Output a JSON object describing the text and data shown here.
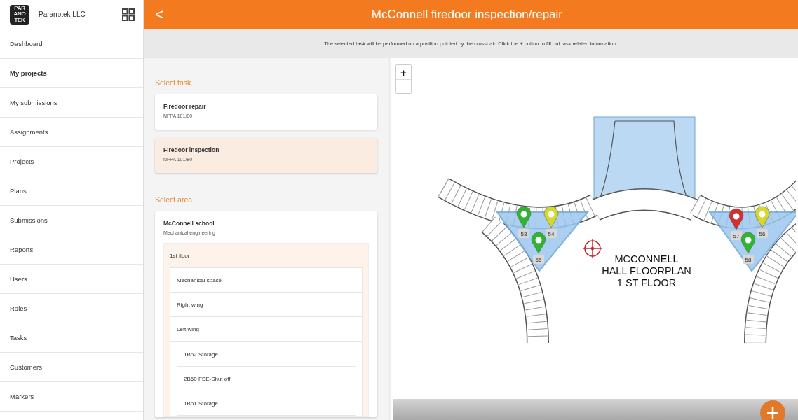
{
  "sidebar": {
    "logo": [
      "PAR",
      "ANO",
      "TEK"
    ],
    "company": "Paranotek LLC",
    "items": [
      {
        "label": "Dashboard",
        "selected": false
      },
      {
        "label": "My projects",
        "selected": true
      },
      {
        "label": "My submissions",
        "selected": false
      },
      {
        "label": "Assignments",
        "selected": false
      },
      {
        "label": "Projects",
        "selected": false
      },
      {
        "label": "Plans",
        "selected": false
      },
      {
        "label": "Submissions",
        "selected": false
      },
      {
        "label": "Reports",
        "selected": false
      },
      {
        "label": "Users",
        "selected": false
      },
      {
        "label": "Roles",
        "selected": false
      },
      {
        "label": "Tasks",
        "selected": false
      },
      {
        "label": "Customers",
        "selected": false
      },
      {
        "label": "Markers",
        "selected": false
      }
    ]
  },
  "header": {
    "back": "<",
    "title": "McConnell firedoor inspection/repair"
  },
  "info": "The selected task will be performed on a position pointed by the crosshair. Click the + button to fill out task related information.",
  "task_section": {
    "heading": "Select task",
    "tasks": [
      {
        "name": "Firedoor repair",
        "code": "NFPA 101/80",
        "selected": false
      },
      {
        "name": "Firedoor inspection",
        "code": "NFPA 101/80",
        "selected": true
      }
    ]
  },
  "area_section": {
    "heading": "Select area",
    "area": {
      "name": "McConnell school",
      "subtitle": "Mechanical engineering",
      "children": [
        {
          "label": "1st floor",
          "children": [
            {
              "label": "Mechanical space"
            },
            {
              "label": "Right wing"
            },
            {
              "label": "Left wing",
              "children": [
                {
                  "label": "1B62 Storage"
                },
                {
                  "label": "2B60 FSE-Shut off"
                },
                {
                  "label": "1B61 Storage"
                }
              ]
            }
          ]
        }
      ]
    }
  },
  "map": {
    "zoom_in": "+",
    "zoom_out": "—",
    "title": [
      "MCCONNELL",
      "HALL FLOORPLAN",
      "1 ST FLOOR"
    ],
    "markers": [
      {
        "label": "53",
        "color": "#2fb52f"
      },
      {
        "label": "54",
        "color": "#d8d82a"
      },
      {
        "label": "55",
        "color": "#2fb52f"
      },
      {
        "label": "57",
        "color": "#d32f2f"
      },
      {
        "label": "56",
        "color": "#d8d82a"
      },
      {
        "label": "58",
        "color": "#2fb52f"
      }
    ]
  }
}
